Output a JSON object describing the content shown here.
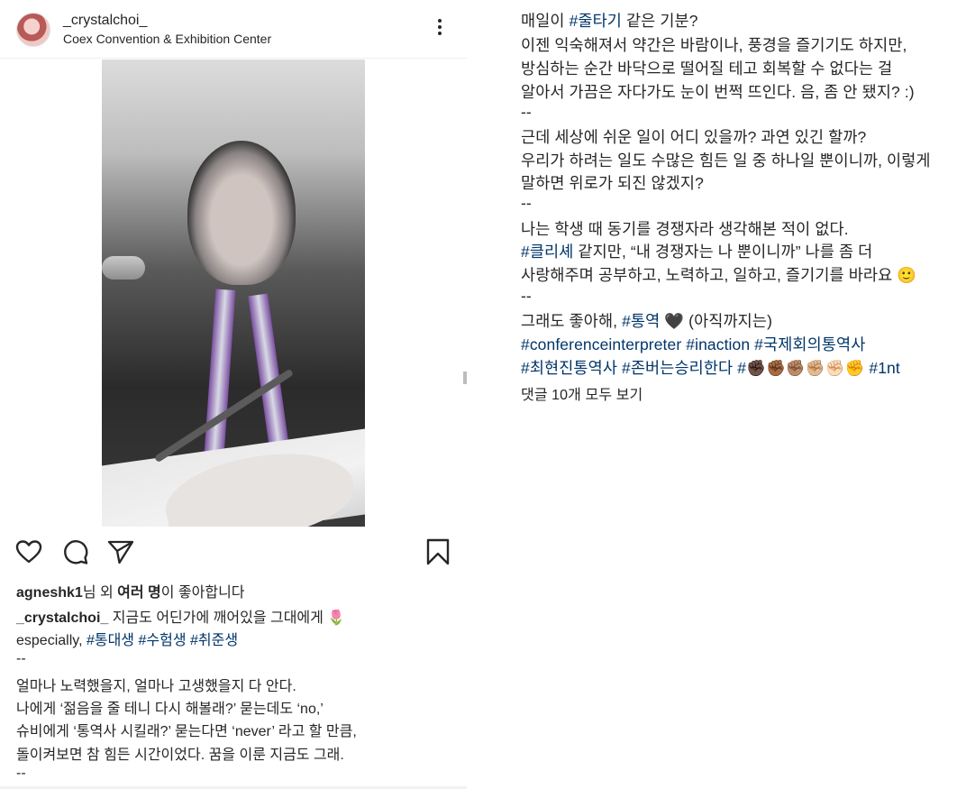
{
  "post": {
    "username": "_crystalchoi_",
    "location": "Coex Convention & Exhibition Center",
    "more_icon": "more-vertical-icon"
  },
  "actions": {
    "like_icon": "heart-icon",
    "comment_icon": "comment-icon",
    "share_icon": "send-icon",
    "save_icon": "bookmark-icon"
  },
  "likes": {
    "user": "agneshk1",
    "mid": "님 외 ",
    "others": "여러 명",
    "suffix": "이 좋아합니다"
  },
  "caption_left": {
    "author": "_crystalchoi_",
    "line1_text": "  지금도 어딘가에 깨어있을 그대에게 🌷",
    "line2_prefix": "especially, ",
    "tags_line2": [
      "#통대생",
      "#수험생",
      "#취준생"
    ],
    "sep1": "--",
    "line3": "얼마나 노력했을지, 얼마나 고생했을지 다 안다.",
    "line4": "나에게 ‘젊음을 줄 테니 다시 해볼래?’ 묻는데도 ‘no,’",
    "line5": "슈비에게 ‘통역사 시킬래?’ 묻는다면 ‘never’ 라고 할 만큼,",
    "line6": "돌이켜보면 참 힘든 시간이었다. 꿈을 이룬 지금도 그래.",
    "sep2": "--"
  },
  "caption_right": {
    "r1_prefix": "매일이 ",
    "r1_tag": "#줄타기",
    "r1_suffix": " 같은 기분?",
    "r2": "이젠 익숙해져서 약간은 바람이나, 풍경을 즐기기도 하지만,",
    "r3": "방심하는 순간 바닥으로 떨어질 테고 회복할 수 없다는 걸",
    "r4": "알아서 가끔은 자다가도 눈이 번쩍 뜨인다. 음, 좀 안 됐지? :)",
    "r5": "--",
    "r6": "근데 세상에 쉬운 일이 어디 있을까? 과연 있긴 할까?",
    "r7": "우리가 하려는 일도 수많은 힘든 일 중 하나일 뿐이니까, 이렇게",
    "r8": "말하면 위로가 되진 않겠지?",
    "r9": "--",
    "r10": "나는 학생 때 동기를 경쟁자라 생각해본 적이 없다.",
    "r11_tag": "#클리셰",
    "r11_suffix": " 같지만, “내 경쟁자는 나 뿐이니까” 나를 좀 더",
    "r12": "사랑해주며 공부하고, 노력하고, 일하고, 즐기기를 바라요 🙂",
    "r13": "--",
    "r14_prefix": "그래도 좋아해, ",
    "r14_tag": "#통역",
    "r14_suffix": " 🖤 (아직까지는)",
    "r15_tags": [
      "#conferenceinterpreter",
      "#inaction",
      "#국제회의통역사"
    ],
    "r16_tags": [
      "#최현진통역사",
      "#존버는승리한다",
      "#✊🏿✊🏾✊🏽✊🏼✊🏻✊",
      "#1nt"
    ],
    "view_comments": "댓글 10개 모두 보기"
  }
}
